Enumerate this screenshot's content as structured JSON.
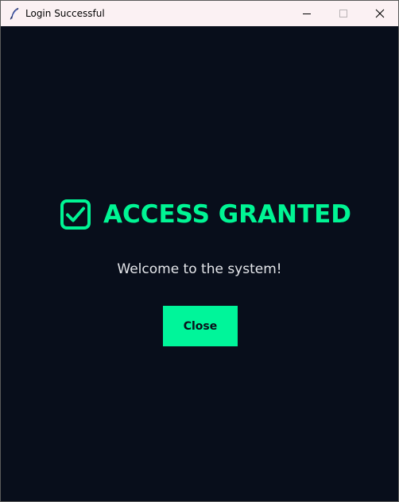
{
  "window": {
    "title": "Login Successful",
    "app_icon": "feather-icon",
    "controls": {
      "minimize_icon": "minimize-icon",
      "maximize_icon": "maximize-icon",
      "close_icon": "close-icon"
    }
  },
  "main": {
    "heading_icon": "checkbox-checked-icon",
    "heading": "ACCESS GRANTED",
    "message": "Welcome to the system!",
    "close_button_label": "Close"
  },
  "colors": {
    "background": "#080e1b",
    "accent": "#00f594",
    "titlebar": "#fbf1f3",
    "text": "#e4e6ea"
  }
}
